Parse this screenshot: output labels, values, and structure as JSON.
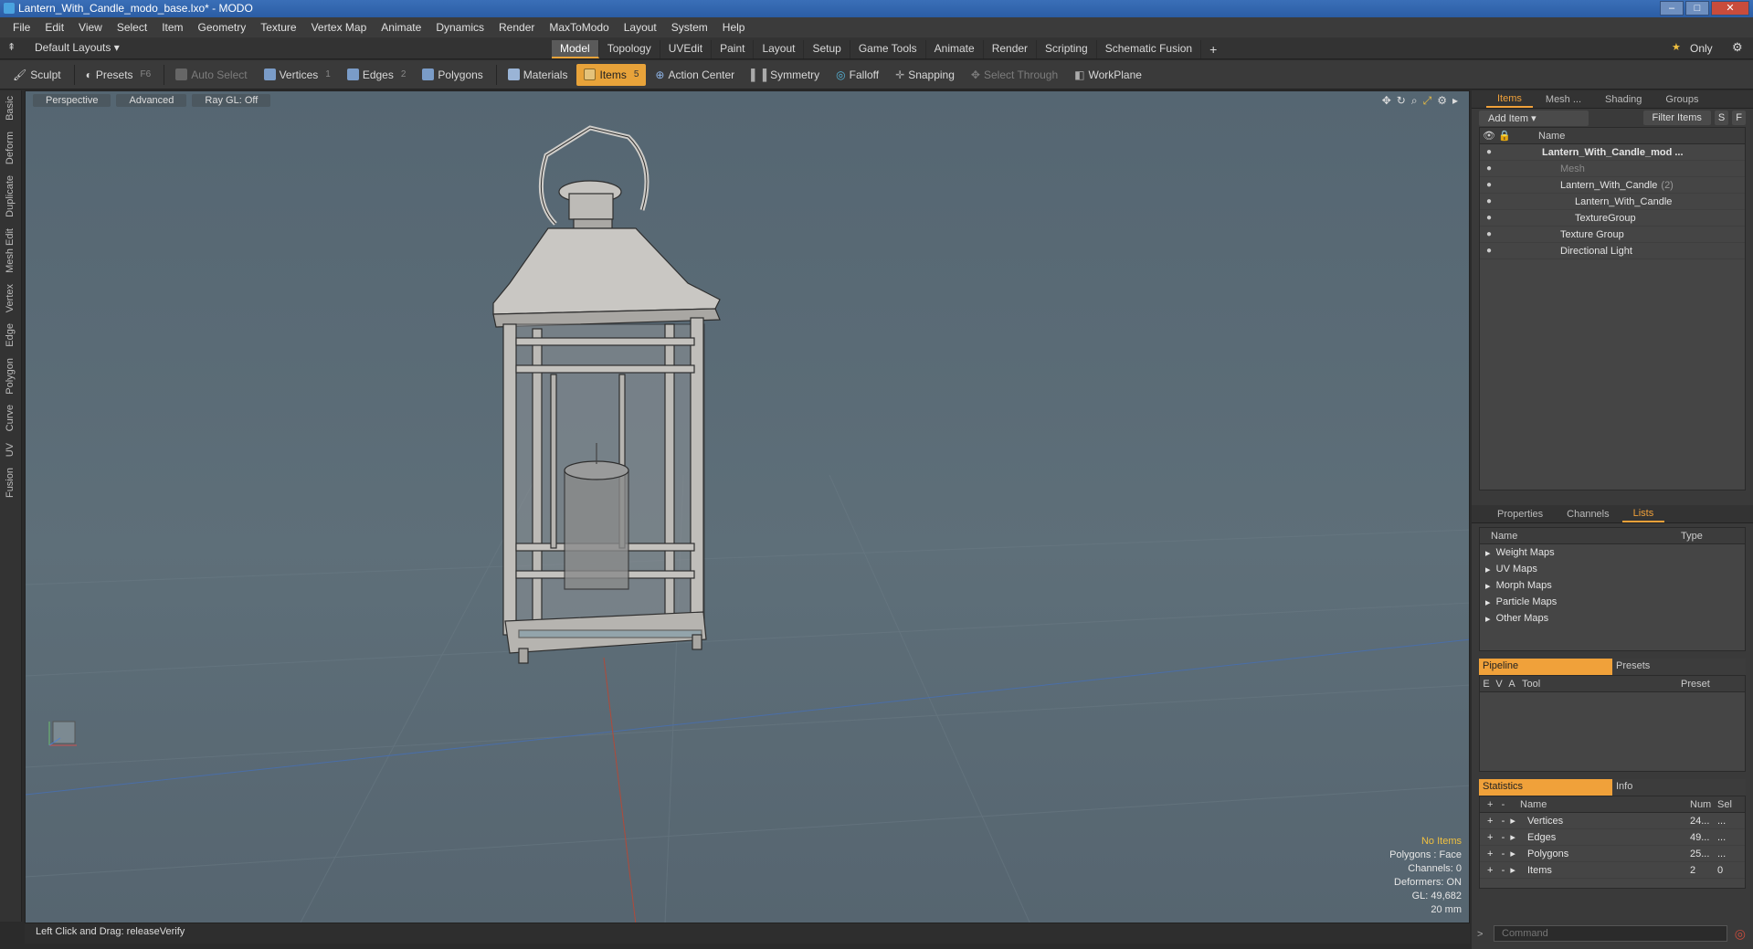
{
  "window": {
    "title": "Lantern_With_Candle_modo_base.lxo* - MODO"
  },
  "menu": [
    "File",
    "Edit",
    "View",
    "Select",
    "Item",
    "Geometry",
    "Texture",
    "Vertex Map",
    "Animate",
    "Dynamics",
    "Render",
    "MaxToModo",
    "Layout",
    "System",
    "Help"
  ],
  "layout": {
    "selector": "Default Layouts",
    "only_label": "Only",
    "tabs": [
      "Model",
      "Topology",
      "UVEdit",
      "Paint",
      "Layout",
      "Setup",
      "Game Tools",
      "Animate",
      "Render",
      "Scripting",
      "Schematic Fusion"
    ]
  },
  "toolbar": {
    "sculpt": "Sculpt",
    "presets": "Presets",
    "presets_key": "F6",
    "auto_select": "Auto Select",
    "vertices": "Vertices",
    "vertices_num": "1",
    "edges": "Edges",
    "edges_num": "2",
    "polygons": "Polygons",
    "materials": "Materials",
    "items": "Items",
    "items_num": "5",
    "action_center": "Action Center",
    "symmetry": "Symmetry",
    "falloff": "Falloff",
    "snapping": "Snapping",
    "select_through": "Select Through",
    "workplane": "WorkPlane"
  },
  "left_tabs": [
    "Basic",
    "Deform",
    "Duplicate",
    "Mesh Edit",
    "Vertex",
    "Edge",
    "Polygon",
    "Curve",
    "UV",
    "Fusion"
  ],
  "viewport": {
    "view": "Perspective",
    "shading": "Advanced",
    "raygl": "Ray GL: Off",
    "overlay": {
      "no_items": "No Items",
      "polygons": "Polygons : Face",
      "channels": "Channels: 0",
      "deformers": "Deformers: ON",
      "gl": "GL: 49,682",
      "scale": "20 mm"
    }
  },
  "status": "Left Click and Drag:  releaseVerify",
  "items_panel": {
    "tabs": [
      "Items",
      "Mesh ...",
      "Shading",
      "Groups"
    ],
    "add_item": "Add Item",
    "filter": "Filter Items",
    "s": "S",
    "f": "F",
    "name_header": "Name",
    "tree": [
      {
        "label": "Lantern_With_Candle_mod ...",
        "indent": 0,
        "bold": true
      },
      {
        "label": "Mesh",
        "indent": 1,
        "dim": true
      },
      {
        "label": "Lantern_With_Candle",
        "extra": "(2)",
        "indent": 1
      },
      {
        "label": "Lantern_With_Candle",
        "indent": 2
      },
      {
        "label": "TextureGroup",
        "indent": 2
      },
      {
        "label": "Texture Group",
        "indent": 1
      },
      {
        "label": "Directional Light",
        "indent": 1
      }
    ]
  },
  "lists_panel": {
    "tabs": [
      "Properties",
      "Channels",
      "Lists"
    ],
    "name_header": "Name",
    "type_header": "Type",
    "items": [
      "Weight Maps",
      "UV Maps",
      "Morph Maps",
      "Particle Maps",
      "Other Maps"
    ]
  },
  "pipeline": {
    "tabs": [
      "Pipeline",
      "Presets"
    ],
    "cols": [
      "E",
      "V",
      "A",
      "Tool",
      "Preset"
    ]
  },
  "statistics": {
    "tabs": [
      "Statistics",
      "Info"
    ],
    "cols": [
      "Name",
      "Num",
      "Sel"
    ],
    "rows": [
      {
        "name": "Vertices",
        "num": "24...",
        "sel": "..."
      },
      {
        "name": "Edges",
        "num": "49...",
        "sel": "..."
      },
      {
        "name": "Polygons",
        "num": "25...",
        "sel": "..."
      },
      {
        "name": "Items",
        "num": "2",
        "sel": "0"
      }
    ]
  },
  "command": {
    "placeholder": "Command"
  }
}
